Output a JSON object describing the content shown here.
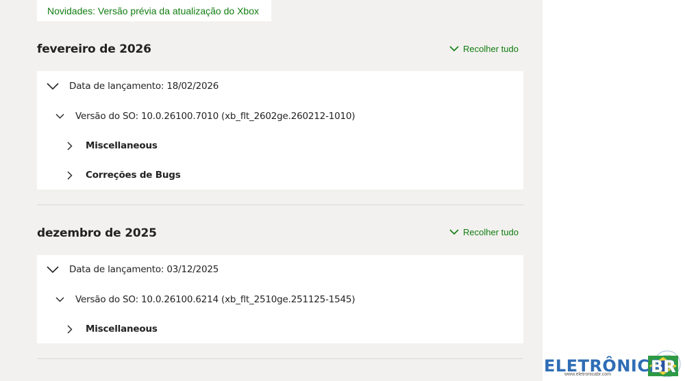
{
  "header": {
    "tab_label": "Novidades: Versão prévia da atualização do Xbox"
  },
  "sections": [
    {
      "title": "fevereiro de 2026",
      "collapse_label": "Recolher tudo",
      "release": "Data de lançamento: 18/02/2026",
      "os_version": "Versão do SO: 10.0.26100.7010 (xb_flt_2602ge.260212-1010)",
      "items": [
        "Miscellaneous",
        "Correções de Bugs"
      ]
    },
    {
      "title": "dezembro de 2025",
      "collapse_label": "Recolher tudo",
      "release": "Data de lançamento: 03/12/2025",
      "os_version": "Versão do SO: 10.0.26100.6214 (xb_flt_2510ge.251125-1545)",
      "items": [
        "Miscellaneous"
      ]
    }
  ],
  "watermark": {
    "brand": "ELETRÔNICA",
    "badge": "BR",
    "url": "www.eletronicabr.com"
  },
  "colors": {
    "accent": "#107c10",
    "page_bg": "#f2f1ef",
    "card_bg": "#ffffff"
  }
}
